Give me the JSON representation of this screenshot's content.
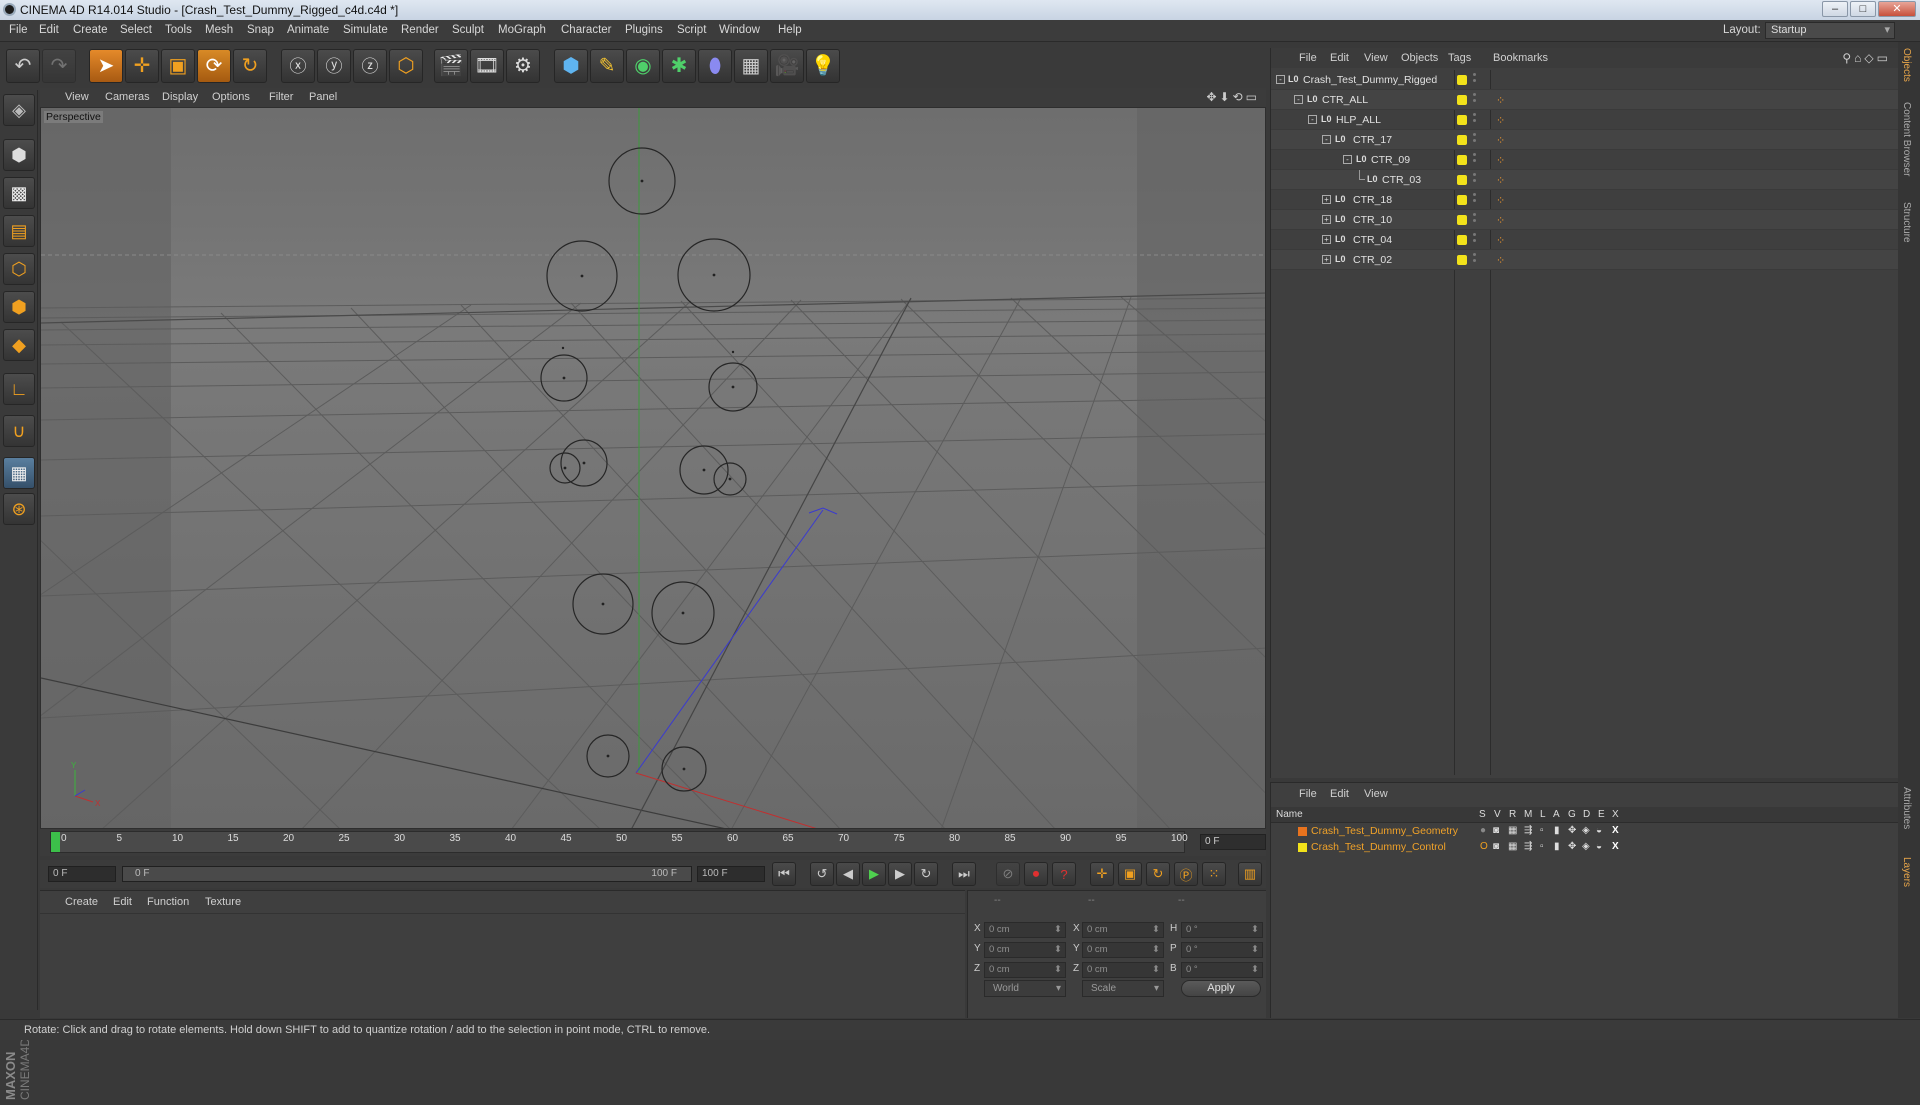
{
  "window": {
    "title": "CINEMA 4D R14.014 Studio - [Crash_Test_Dummy_Rigged_c4d.c4d *]"
  },
  "menu": [
    "File",
    "Edit",
    "Create",
    "Select",
    "Tools",
    "Mesh",
    "Snap",
    "Animate",
    "Simulate",
    "Render",
    "Sculpt",
    "MoGraph",
    "Character",
    "Plugins",
    "Script",
    "Window",
    "Help"
  ],
  "layout": {
    "label": "Layout:",
    "value": "Startup"
  },
  "toolbar_icons": [
    "undo-icon",
    "redo-icon",
    "live-selection-icon",
    "move-icon",
    "scale-icon",
    "rotate-icon",
    "rotate-alt-icon",
    "x-axis-lock-icon",
    "y-axis-lock-icon",
    "z-axis-lock-icon",
    "coordinate-system-icon",
    "render-view-icon",
    "render-picture-viewer-icon",
    "render-settings-icon",
    "cube-icon",
    "spline-pen-icon",
    "nurbs-icon",
    "array-icon",
    "deformer-icon",
    "floor-icon",
    "camera-icon",
    "light-icon"
  ],
  "left_icons": [
    "make-editable-icon",
    "model-mode-icon",
    "texture-mode-icon",
    "workplane-mode-icon",
    "points-mode-icon",
    "edges-mode-icon",
    "polygons-mode-icon",
    "axis-mode-icon",
    "magnet-icon",
    "snap-icon",
    "soft-selection-icon"
  ],
  "viewport": {
    "menu": [
      "View",
      "Cameras",
      "Display",
      "Options",
      "Filter",
      "Panel"
    ],
    "label": "Perspective"
  },
  "timeline": {
    "ticks": [
      "0",
      "5",
      "10",
      "15",
      "20",
      "25",
      "30",
      "35",
      "40",
      "45",
      "50",
      "55",
      "60",
      "65",
      "70",
      "75",
      "80",
      "85",
      "90",
      "95",
      "100"
    ],
    "current_frame": "0 F"
  },
  "anim": {
    "start": "0 F",
    "range_start": "0 F",
    "range_end": "100 F",
    "end": "100 F"
  },
  "material_panel": {
    "menu": [
      "Create",
      "Edit",
      "Function",
      "Texture"
    ]
  },
  "coords": {
    "headers": [
      "--",
      "--",
      "--"
    ],
    "rows": [
      {
        "a": "X",
        "av": "0 cm",
        "b": "X",
        "bv": "0 cm",
        "c": "H",
        "cv": "0 °"
      },
      {
        "a": "Y",
        "av": "0 cm",
        "b": "Y",
        "bv": "0 cm",
        "c": "P",
        "cv": "0 °"
      },
      {
        "a": "Z",
        "av": "0 cm",
        "b": "Z",
        "bv": "0 cm",
        "c": "B",
        "cv": "0 °"
      }
    ],
    "space": "World",
    "mode": "Scale",
    "apply": "Apply"
  },
  "objects": {
    "menu": [
      "File",
      "Edit",
      "View",
      "Objects",
      "Tags",
      "Bookmarks"
    ],
    "items": [
      {
        "name": "Crash_Test_Dummy_Rigged",
        "depth": 0,
        "exp": "-"
      },
      {
        "name": "CTR_ALL",
        "depth": 1,
        "exp": "-"
      },
      {
        "name": "HLP_ALL",
        "depth": 2,
        "exp": "-"
      },
      {
        "name": "CTR_17",
        "depth": 3,
        "exp": "-"
      },
      {
        "name": "CTR_09",
        "depth": 4,
        "exp": "-"
      },
      {
        "name": "CTR_03",
        "depth": 5,
        "exp": ""
      },
      {
        "name": "CTR_18",
        "depth": 3,
        "exp": "+"
      },
      {
        "name": "CTR_10",
        "depth": 3,
        "exp": "+"
      },
      {
        "name": "CTR_04",
        "depth": 3,
        "exp": "+"
      },
      {
        "name": "CTR_02",
        "depth": 3,
        "exp": "+"
      }
    ]
  },
  "layers": {
    "menu": [
      "File",
      "Edit",
      "View"
    ],
    "columns": [
      "Name",
      "S",
      "V",
      "R",
      "M",
      "L",
      "A",
      "G",
      "D",
      "E",
      "X"
    ],
    "items": [
      {
        "name": "Crash_Test_Dummy_Geometry",
        "color": "#e8731e"
      },
      {
        "name": "Crash_Test_Dummy_Control",
        "color": "#f2e21a"
      }
    ]
  },
  "side_tabs": [
    "Objects",
    "Content Browser",
    "Structure",
    "Attributes",
    "Layers"
  ],
  "status": "Rotate: Click and drag to rotate elements. Hold down SHIFT to add to quantize rotation / add to the selection in point mode, CTRL to remove."
}
